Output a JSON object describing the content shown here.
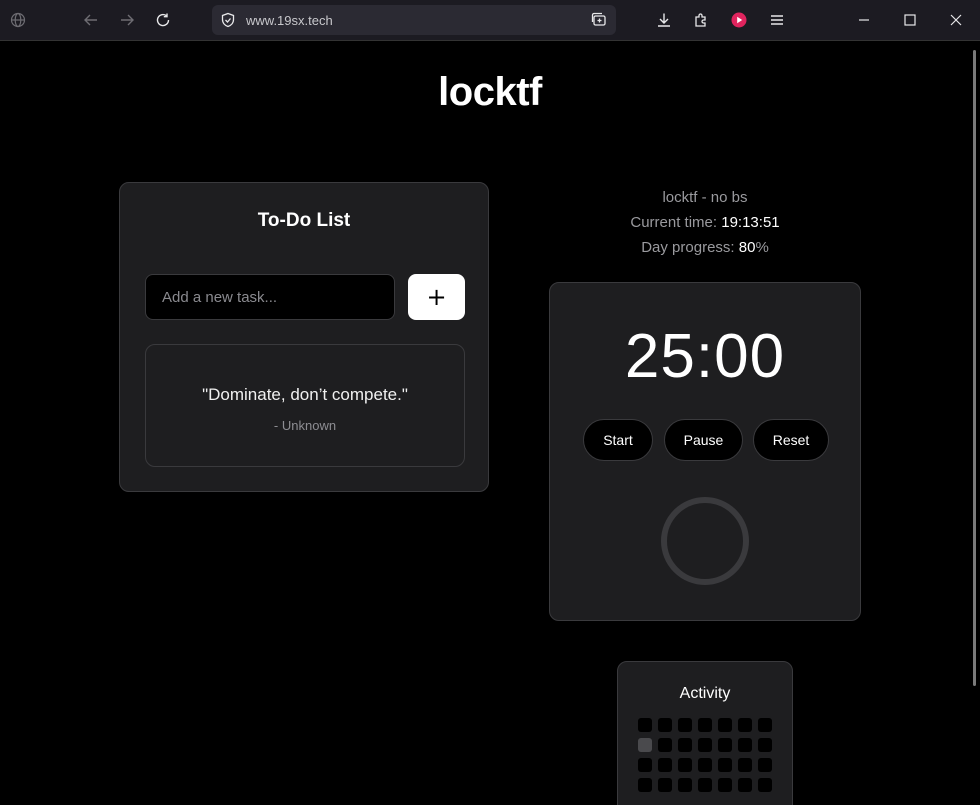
{
  "browser": {
    "url": "www.19sx.tech",
    "icons": [
      "globe-icon",
      "back-icon",
      "forward-icon",
      "reload-icon",
      "shield-icon",
      "tabs-icon",
      "download-icon",
      "extensions-icon",
      "media-icon",
      "menu-icon",
      "minimize-icon",
      "maximize-icon",
      "close-icon"
    ]
  },
  "page": {
    "title": "locktf"
  },
  "todo": {
    "title": "To-Do List",
    "input_placeholder": "Add a new task...",
    "add_label": "+",
    "quote": "\"Dominate, don’t compete.\"",
    "author": "- Unknown"
  },
  "info": {
    "tagline": "locktf - no bs",
    "time_label": "Current time:",
    "time_value": "19:13:51",
    "progress_label": "Day progress:",
    "progress_value": "80",
    "progress_unit": "%"
  },
  "timer": {
    "display": "25:00",
    "start_label": "Start",
    "pause_label": "Pause",
    "reset_label": "Reset",
    "progress_fraction": 0
  },
  "activity": {
    "title": "Activity",
    "rows": [
      [
        0,
        0,
        0,
        0,
        0,
        0,
        0
      ],
      [
        1,
        0,
        0,
        0,
        0,
        0,
        0
      ],
      [
        0,
        0,
        0,
        0,
        0,
        0,
        0
      ],
      [
        0,
        0,
        0,
        0,
        0,
        0,
        0
      ]
    ]
  },
  "colors": {
    "background": "#000000",
    "card": "#1e1e20",
    "border": "#3a3a3d",
    "muted_text": "#9a9a9e"
  }
}
